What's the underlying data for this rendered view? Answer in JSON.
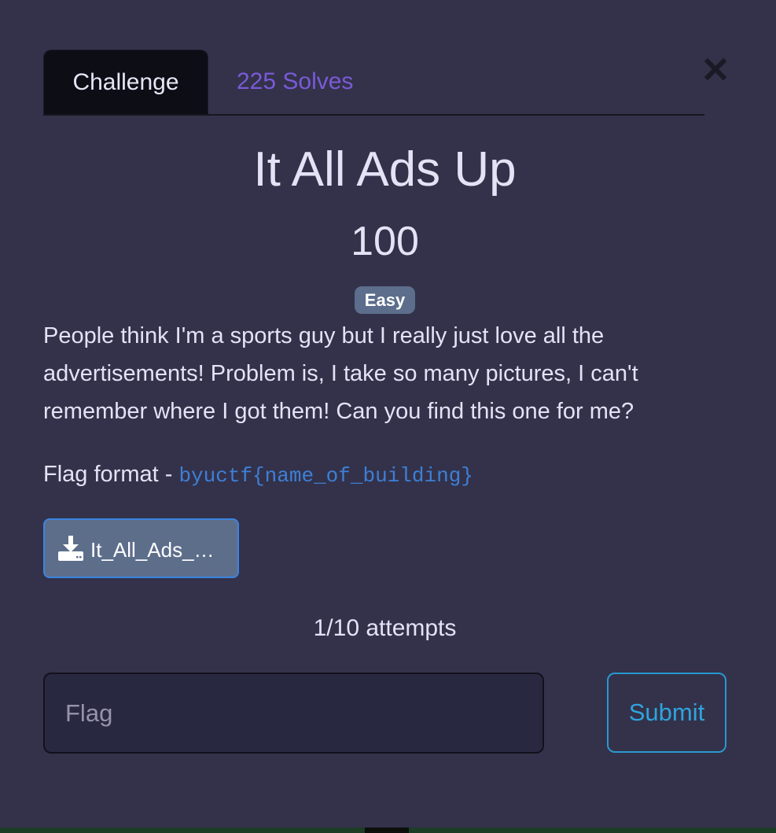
{
  "tabs": {
    "challenge_label": "Challenge",
    "solves_label": "225 Solves"
  },
  "challenge": {
    "title": "It All Ads Up",
    "points": "100",
    "difficulty": "Easy",
    "description": "People think I'm a sports guy but I really just love all the advertisements! Problem is, I take so many pictures, I can't remember where I got them! Can you find this one for me?",
    "flag_format_label": "Flag format - ",
    "flag_format_code": "byuctf{name_of_building}"
  },
  "download": {
    "filename": "It_All_Ads_Up.jpg",
    "icon": "download-icon"
  },
  "attempts_text": "1/10 attempts",
  "form": {
    "flag_placeholder": "Flag",
    "submit_label": "Submit"
  },
  "close_icon": "close-icon",
  "colors": {
    "modal_bg": "#33324a",
    "accent_purple": "#7b5ad8",
    "accent_blue": "#2fa3dc",
    "badge_bg": "#5c6e8c"
  }
}
